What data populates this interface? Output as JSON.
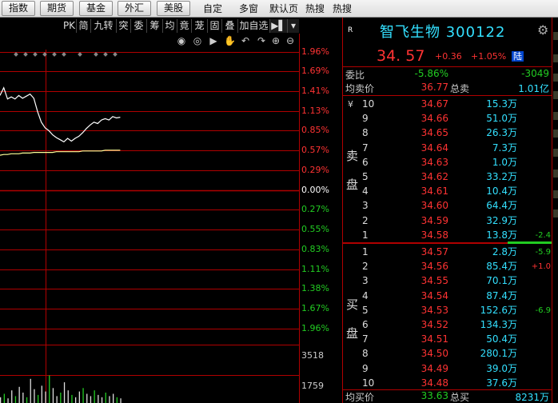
{
  "topbar": {
    "buttons": [
      "指数",
      "期货",
      "基金",
      "外汇",
      "美股"
    ],
    "links": [
      "自定",
      "多窗",
      "默认页",
      "热搜",
      "热搜"
    ]
  },
  "toolbar": {
    "items": [
      "PK",
      "简",
      "九转",
      "突",
      "委",
      "筹",
      "均",
      "竟",
      "茏",
      "固",
      "叠",
      "加自选"
    ]
  },
  "icons": [
    "eye-icon",
    "eye-dim-icon",
    "play-icon",
    "hand-icon",
    "undo-icon",
    "redo-icon",
    "zoom-in-icon",
    "zoom-out-icon"
  ],
  "chart_data": {
    "type": "line",
    "right_axis_pct": [
      "1.96%",
      "1.69%",
      "1.41%",
      "1.13%",
      "0.85%",
      "0.57%",
      "0.29%",
      "0.00%",
      "0.27%",
      "0.55%",
      "0.83%",
      "1.11%",
      "1.38%",
      "1.67%",
      "1.96%"
    ],
    "volume_ticks": [
      "3518",
      "1759"
    ],
    "price_line": {
      "color": "#ffffff",
      "pct": [
        1.35,
        1.46,
        1.3,
        1.33,
        1.3,
        1.35,
        1.31,
        1.34,
        1.37,
        1.31,
        1.12,
        0.97,
        0.89,
        0.85,
        0.79,
        0.75,
        0.72,
        0.69,
        0.74,
        0.7,
        0.74,
        0.77,
        0.82,
        0.88,
        0.93,
        0.97,
        0.95,
        1.0,
        1.02,
        1.0,
        1.05,
        1.03,
        1.04
      ]
    },
    "avg_line": {
      "color": "#ffff99",
      "pct": [
        0.5,
        0.51,
        0.51,
        0.52,
        0.52,
        0.52,
        0.53,
        0.53,
        0.53,
        0.54,
        0.54,
        0.54,
        0.54,
        0.54,
        0.54,
        0.55,
        0.55,
        0.55,
        0.55,
        0.55,
        0.55,
        0.55,
        0.56,
        0.56,
        0.56,
        0.56,
        0.56,
        0.56,
        0.57,
        0.57,
        0.57,
        0.57,
        0.57
      ]
    },
    "volume": [
      10,
      16,
      8,
      22,
      12,
      28,
      18,
      10,
      42,
      24,
      14,
      30,
      20,
      48,
      26,
      12,
      18,
      36,
      22,
      14,
      10,
      20,
      26,
      16,
      12,
      22,
      14,
      10,
      18,
      12,
      16,
      10,
      8
    ]
  },
  "quote": {
    "tag": "R",
    "name": "智飞生物 300122",
    "last": "34. 57",
    "change": "+0.36",
    "change_pct": "+1.05%",
    "lu": "陆",
    "weibi_label": "委比",
    "weibi": "-5.86%",
    "weicha": "-3049",
    "avg_sell_label": "均卖价",
    "avg_sell": "36.77",
    "total_sell_label": "总卖",
    "total_sell": "1.01亿",
    "yen": "¥",
    "sell_label": [
      "卖",
      "盘"
    ],
    "buy_label": [
      "买",
      "盘"
    ],
    "asks": [
      {
        "lv": "10",
        "price": "34.67",
        "qty": "15.3万",
        "d": ""
      },
      {
        "lv": "9",
        "price": "34.66",
        "qty": "51.0万",
        "d": ""
      },
      {
        "lv": "8",
        "price": "34.65",
        "qty": "26.3万",
        "d": ""
      },
      {
        "lv": "7",
        "price": "34.64",
        "qty": "7.3万",
        "d": ""
      },
      {
        "lv": "6",
        "price": "34.63",
        "qty": "1.0万",
        "d": ""
      },
      {
        "lv": "5",
        "price": "34.62",
        "qty": "33.2万",
        "d": ""
      },
      {
        "lv": "4",
        "price": "34.61",
        "qty": "10.4万",
        "d": ""
      },
      {
        "lv": "3",
        "price": "34.60",
        "qty": "64.4万",
        "d": ""
      },
      {
        "lv": "2",
        "price": "34.59",
        "qty": "32.9万",
        "d": ""
      },
      {
        "lv": "1",
        "price": "34.58",
        "qty": "13.8万",
        "d": "-2.4"
      }
    ],
    "bids": [
      {
        "lv": "1",
        "price": "34.57",
        "qty": "2.8万",
        "d": "-5.9"
      },
      {
        "lv": "2",
        "price": "34.56",
        "qty": "85.4万",
        "d": "+1.0"
      },
      {
        "lv": "3",
        "price": "34.55",
        "qty": "70.1万",
        "d": ""
      },
      {
        "lv": "4",
        "price": "34.54",
        "qty": "87.4万",
        "d": ""
      },
      {
        "lv": "5",
        "price": "34.53",
        "qty": "152.6万",
        "d": "-6.9"
      },
      {
        "lv": "6",
        "price": "34.52",
        "qty": "134.3万",
        "d": ""
      },
      {
        "lv": "7",
        "price": "34.51",
        "qty": "50.4万",
        "d": ""
      },
      {
        "lv": "8",
        "price": "34.50",
        "qty": "280.1万",
        "d": ""
      },
      {
        "lv": "9",
        "price": "34.49",
        "qty": "39.0万",
        "d": ""
      },
      {
        "lv": "10",
        "price": "34.48",
        "qty": "37.6万",
        "d": ""
      }
    ],
    "avg_buy_label": "均买价",
    "avg_buy": "33.63",
    "total_buy_label": "总买",
    "total_buy": "8231万"
  },
  "colors": {
    "up": "#ff3333",
    "down": "#22cc22",
    "cyan": "#33e0ff",
    "grid": "#b00000"
  }
}
